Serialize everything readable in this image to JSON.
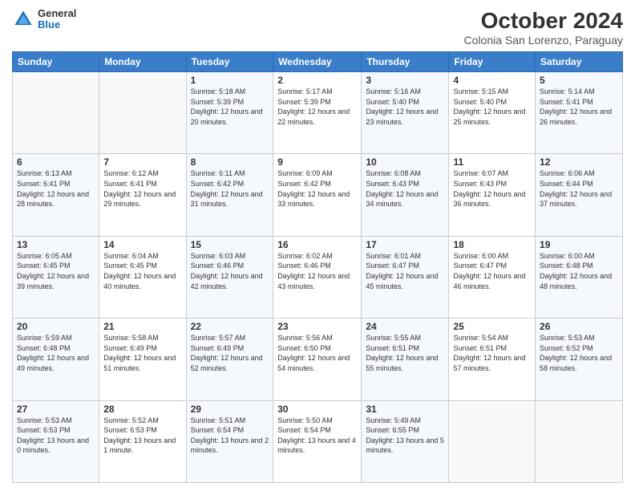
{
  "header": {
    "logo_general": "General",
    "logo_blue": "Blue",
    "month_title": "October 2024",
    "location": "Colonia San Lorenzo, Paraguay"
  },
  "days_of_week": [
    "Sunday",
    "Monday",
    "Tuesday",
    "Wednesday",
    "Thursday",
    "Friday",
    "Saturday"
  ],
  "weeks": [
    [
      {
        "day": "",
        "sunrise": "",
        "sunset": "",
        "daylight": ""
      },
      {
        "day": "",
        "sunrise": "",
        "sunset": "",
        "daylight": ""
      },
      {
        "day": "1",
        "sunrise": "Sunrise: 5:18 AM",
        "sunset": "Sunset: 5:39 PM",
        "daylight": "Daylight: 12 hours and 20 minutes."
      },
      {
        "day": "2",
        "sunrise": "Sunrise: 5:17 AM",
        "sunset": "Sunset: 5:39 PM",
        "daylight": "Daylight: 12 hours and 22 minutes."
      },
      {
        "day": "3",
        "sunrise": "Sunrise: 5:16 AM",
        "sunset": "Sunset: 5:40 PM",
        "daylight": "Daylight: 12 hours and 23 minutes."
      },
      {
        "day": "4",
        "sunrise": "Sunrise: 5:15 AM",
        "sunset": "Sunset: 5:40 PM",
        "daylight": "Daylight: 12 hours and 25 minutes."
      },
      {
        "day": "5",
        "sunrise": "Sunrise: 5:14 AM",
        "sunset": "Sunset: 5:41 PM",
        "daylight": "Daylight: 12 hours and 26 minutes."
      }
    ],
    [
      {
        "day": "6",
        "sunrise": "Sunrise: 6:13 AM",
        "sunset": "Sunset: 6:41 PM",
        "daylight": "Daylight: 12 hours and 28 minutes."
      },
      {
        "day": "7",
        "sunrise": "Sunrise: 6:12 AM",
        "sunset": "Sunset: 6:41 PM",
        "daylight": "Daylight: 12 hours and 29 minutes."
      },
      {
        "day": "8",
        "sunrise": "Sunrise: 6:11 AM",
        "sunset": "Sunset: 6:42 PM",
        "daylight": "Daylight: 12 hours and 31 minutes."
      },
      {
        "day": "9",
        "sunrise": "Sunrise: 6:09 AM",
        "sunset": "Sunset: 6:42 PM",
        "daylight": "Daylight: 12 hours and 33 minutes."
      },
      {
        "day": "10",
        "sunrise": "Sunrise: 6:08 AM",
        "sunset": "Sunset: 6:43 PM",
        "daylight": "Daylight: 12 hours and 34 minutes."
      },
      {
        "day": "11",
        "sunrise": "Sunrise: 6:07 AM",
        "sunset": "Sunset: 6:43 PM",
        "daylight": "Daylight: 12 hours and 36 minutes."
      },
      {
        "day": "12",
        "sunrise": "Sunrise: 6:06 AM",
        "sunset": "Sunset: 6:44 PM",
        "daylight": "Daylight: 12 hours and 37 minutes."
      }
    ],
    [
      {
        "day": "13",
        "sunrise": "Sunrise: 6:05 AM",
        "sunset": "Sunset: 6:45 PM",
        "daylight": "Daylight: 12 hours and 39 minutes."
      },
      {
        "day": "14",
        "sunrise": "Sunrise: 6:04 AM",
        "sunset": "Sunset: 6:45 PM",
        "daylight": "Daylight: 12 hours and 40 minutes."
      },
      {
        "day": "15",
        "sunrise": "Sunrise: 6:03 AM",
        "sunset": "Sunset: 6:46 PM",
        "daylight": "Daylight: 12 hours and 42 minutes."
      },
      {
        "day": "16",
        "sunrise": "Sunrise: 6:02 AM",
        "sunset": "Sunset: 6:46 PM",
        "daylight": "Daylight: 12 hours and 43 minutes."
      },
      {
        "day": "17",
        "sunrise": "Sunrise: 6:01 AM",
        "sunset": "Sunset: 6:47 PM",
        "daylight": "Daylight: 12 hours and 45 minutes."
      },
      {
        "day": "18",
        "sunrise": "Sunrise: 6:00 AM",
        "sunset": "Sunset: 6:47 PM",
        "daylight": "Daylight: 12 hours and 46 minutes."
      },
      {
        "day": "19",
        "sunrise": "Sunrise: 6:00 AM",
        "sunset": "Sunset: 6:48 PM",
        "daylight": "Daylight: 12 hours and 48 minutes."
      }
    ],
    [
      {
        "day": "20",
        "sunrise": "Sunrise: 5:59 AM",
        "sunset": "Sunset: 6:48 PM",
        "daylight": "Daylight: 12 hours and 49 minutes."
      },
      {
        "day": "21",
        "sunrise": "Sunrise: 5:58 AM",
        "sunset": "Sunset: 6:49 PM",
        "daylight": "Daylight: 12 hours and 51 minutes."
      },
      {
        "day": "22",
        "sunrise": "Sunrise: 5:57 AM",
        "sunset": "Sunset: 6:49 PM",
        "daylight": "Daylight: 12 hours and 52 minutes."
      },
      {
        "day": "23",
        "sunrise": "Sunrise: 5:56 AM",
        "sunset": "Sunset: 6:50 PM",
        "daylight": "Daylight: 12 hours and 54 minutes."
      },
      {
        "day": "24",
        "sunrise": "Sunrise: 5:55 AM",
        "sunset": "Sunset: 6:51 PM",
        "daylight": "Daylight: 12 hours and 55 minutes."
      },
      {
        "day": "25",
        "sunrise": "Sunrise: 5:54 AM",
        "sunset": "Sunset: 6:51 PM",
        "daylight": "Daylight: 12 hours and 57 minutes."
      },
      {
        "day": "26",
        "sunrise": "Sunrise: 5:53 AM",
        "sunset": "Sunset: 6:52 PM",
        "daylight": "Daylight: 12 hours and 58 minutes."
      }
    ],
    [
      {
        "day": "27",
        "sunrise": "Sunrise: 5:53 AM",
        "sunset": "Sunset: 6:53 PM",
        "daylight": "Daylight: 13 hours and 0 minutes."
      },
      {
        "day": "28",
        "sunrise": "Sunrise: 5:52 AM",
        "sunset": "Sunset: 6:53 PM",
        "daylight": "Daylight: 13 hours and 1 minute."
      },
      {
        "day": "29",
        "sunrise": "Sunrise: 5:51 AM",
        "sunset": "Sunset: 6:54 PM",
        "daylight": "Daylight: 13 hours and 2 minutes."
      },
      {
        "day": "30",
        "sunrise": "Sunrise: 5:50 AM",
        "sunset": "Sunset: 6:54 PM",
        "daylight": "Daylight: 13 hours and 4 minutes."
      },
      {
        "day": "31",
        "sunrise": "Sunrise: 5:49 AM",
        "sunset": "Sunset: 6:55 PM",
        "daylight": "Daylight: 13 hours and 5 minutes."
      },
      {
        "day": "",
        "sunrise": "",
        "sunset": "",
        "daylight": ""
      },
      {
        "day": "",
        "sunrise": "",
        "sunset": "",
        "daylight": ""
      }
    ]
  ]
}
